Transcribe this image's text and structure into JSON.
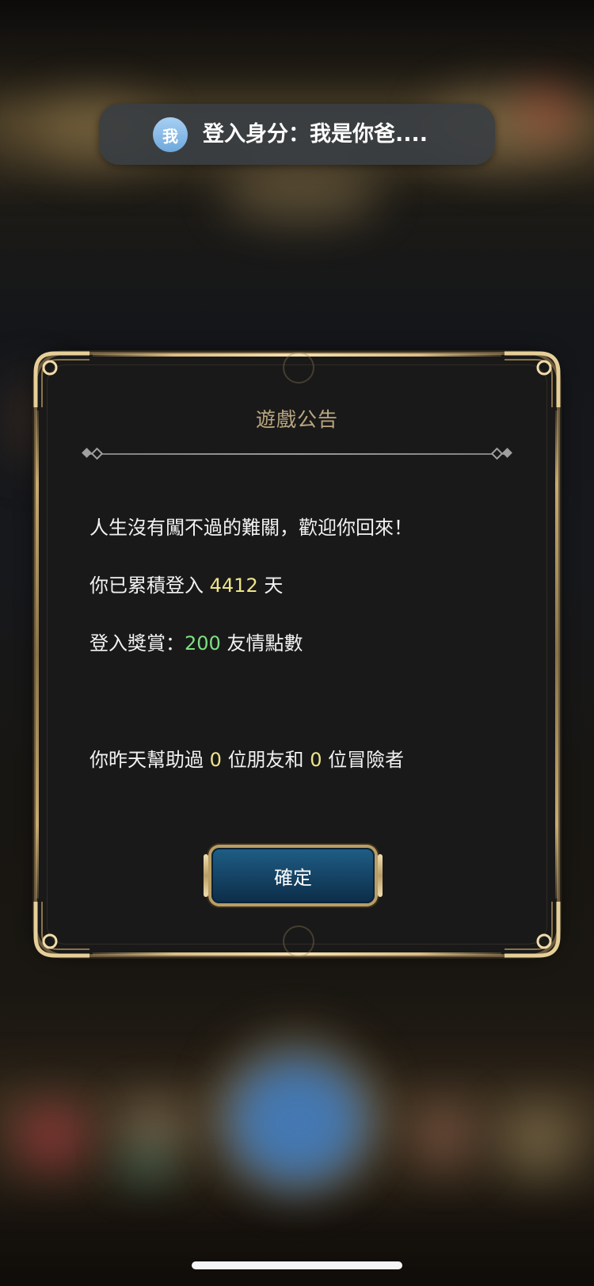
{
  "login_toast": {
    "avatar_text": "我",
    "text": "登入身分：我是你爸...."
  },
  "dialog": {
    "title": "遊戲公告",
    "welcome": "人生沒有闖不過的難關，歡迎你回來！",
    "login_days": {
      "prefix": "你已累積登入",
      "value": "4412",
      "suffix": "天"
    },
    "login_reward": {
      "prefix": "登入獎賞：",
      "value": "200",
      "suffix": "友情點數"
    },
    "helped": {
      "prefix": "你昨天幫助過",
      "friends_count": "0",
      "middle": "位朋友和",
      "adventurers_count": "0",
      "suffix": "位冒險者"
    },
    "confirm_label": "確定"
  },
  "colors": {
    "highlight_yellow": "#eee48a",
    "highlight_green": "#7be082",
    "title_gold": "#b9a780",
    "button_blue": "#16476a",
    "frame_gold": "#d9bd85"
  }
}
